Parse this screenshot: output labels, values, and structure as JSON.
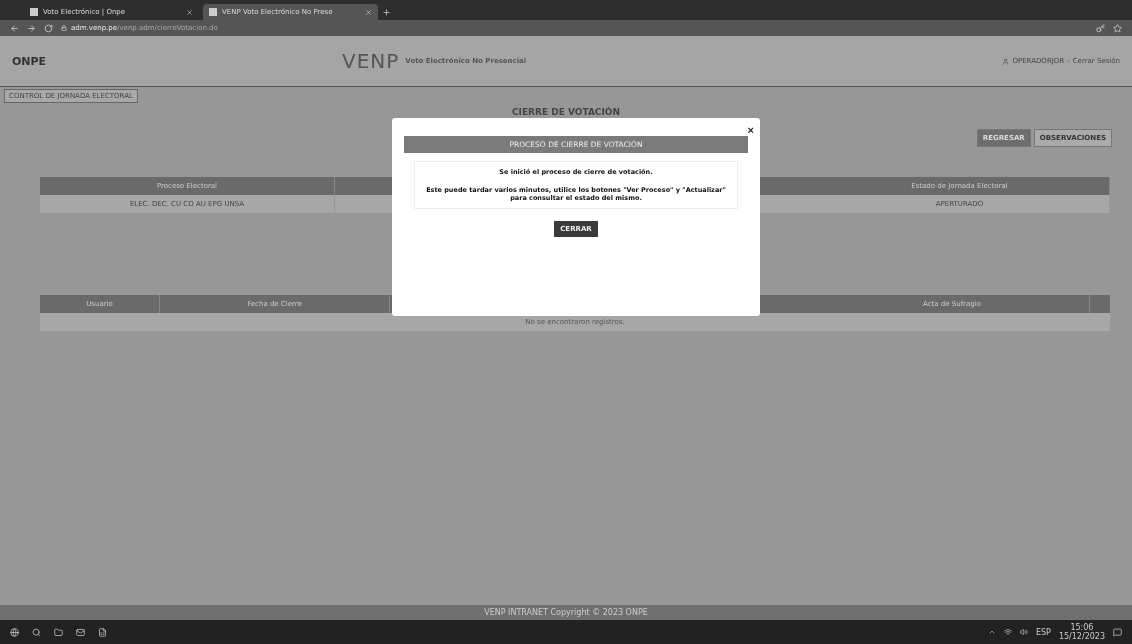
{
  "browser": {
    "tabs": [
      {
        "title": "Voto Electrónico | Onpe",
        "selected": false
      },
      {
        "title": "VENP Voto Electrónico No Prese",
        "selected": true
      }
    ],
    "url_host": "adm.venp.pe",
    "url_path": "/venp.adm/cierreVotacion.do"
  },
  "header": {
    "logo": "ONPE",
    "brand": "VENP",
    "subtitle": "Voto Electrónico No Presencial",
    "user": "OPERADORJOR",
    "separator": "-",
    "logout": "Cerrar Sesión"
  },
  "breadcrumb": "CONTROL DE JORNADA ELECTORAL",
  "page_title": "CIERRE DE VOTACIÓN",
  "actions": [
    {
      "label": "REGRESAR",
      "primary": true
    },
    {
      "label": "OBSERVACIONES",
      "primary": false
    }
  ],
  "process_table": {
    "columns": [
      "Proceso Electoral",
      "Estado de Jornada Electoral"
    ],
    "rows": [
      [
        "ELEC. DEC. CU CO AU EPG UNSA",
        "APERTURADO"
      ]
    ]
  },
  "closing_table": {
    "columns": [
      "Usuario",
      "Fecha de Cierre",
      "Acta de Sufragio"
    ],
    "empty": "No se encontraron registros."
  },
  "modal": {
    "title": "PROCESO DE CIERRE DE VOTACIÓN",
    "message": "Se inició el proceso de cierre de votación.",
    "detail": "Este puede tardar varios minutos, utilice los botones \"Ver Proceso\" y \"Actualizar\" para consultar el estado del mismo.",
    "button": "CERRAR",
    "close": "×"
  },
  "footer": "VENP INTRANET Copyright © 2023 ONPE",
  "taskbar": {
    "language": "ESP",
    "time": "15:06",
    "date": "15/12/2023"
  }
}
